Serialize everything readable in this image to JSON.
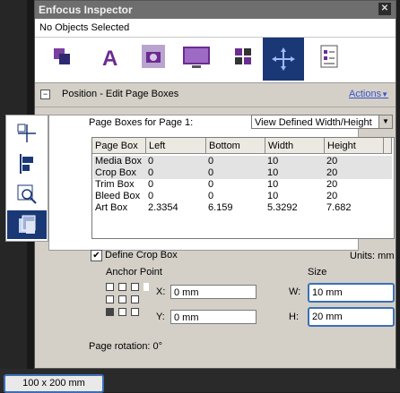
{
  "window": {
    "title": "Enfocus Inspector"
  },
  "selection_status": "No Objects Selected",
  "tabs": [
    {
      "icon": "layers-icon"
    },
    {
      "icon": "text-a-icon"
    },
    {
      "icon": "camera-icon"
    },
    {
      "icon": "monitor-icon"
    },
    {
      "icon": "grid-squares-icon"
    },
    {
      "icon": "page-boxes-icon",
      "active": true
    },
    {
      "icon": "document-list-icon"
    }
  ],
  "panel": {
    "title": "Position - Edit Page Boxes",
    "actions_label": "Actions"
  },
  "page_boxes": {
    "label": "Page Boxes for Page 1:",
    "view_selected": "View Defined Width/Height",
    "columns": [
      "Page Box",
      "Left",
      "Bottom",
      "Width",
      "Height"
    ],
    "rows": [
      [
        "Media Box",
        "0",
        "0",
        "10",
        "20"
      ],
      [
        "Crop Box",
        "0",
        "0",
        "10",
        "20"
      ],
      [
        "Trim Box",
        "0",
        "0",
        "10",
        "20"
      ],
      [
        "Bleed Box",
        "0",
        "0",
        "10",
        "20"
      ],
      [
        "Art Box",
        "2.3354",
        "6.159",
        "5.3292",
        "7.682"
      ]
    ]
  },
  "define_crop_box": {
    "label": "Define Crop Box",
    "checked": true
  },
  "units": "Units: mm",
  "anchor_point_label": "Anchor Point",
  "size_label": "Size",
  "fields": {
    "x_label": "X:",
    "x_value": "0 mm",
    "y_label": "Y:",
    "y_value": "0 mm",
    "w_label": "W:",
    "w_value": "10 mm",
    "h_label": "H:",
    "h_value": "20 mm"
  },
  "page_rotation": "Page rotation: 0°",
  "page_size_readout": "100 x 200 mm",
  "colors": {
    "accent": "#1a3876",
    "focus": "#3b6fb6",
    "link": "#3a55c8",
    "selected_row": "#e3e3e3"
  }
}
